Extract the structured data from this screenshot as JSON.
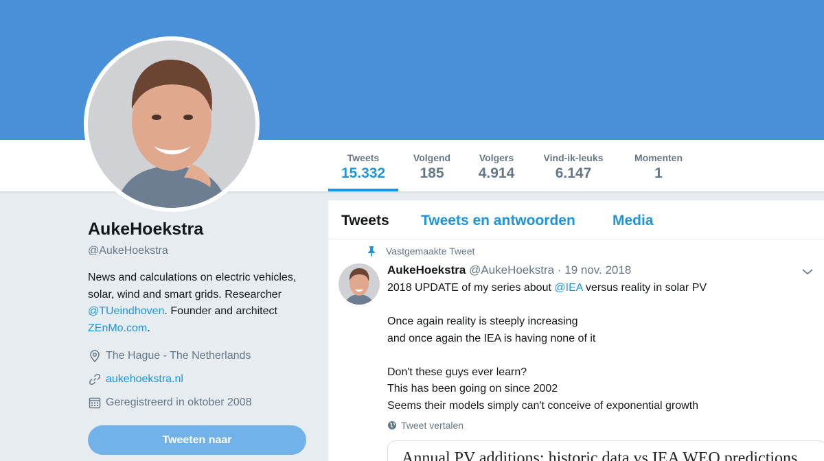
{
  "stats": [
    {
      "label": "Tweets",
      "value": "15.332"
    },
    {
      "label": "Volgend",
      "value": "185"
    },
    {
      "label": "Volgers",
      "value": "4.914"
    },
    {
      "label": "Vind-ik-leuks",
      "value": "6.147"
    },
    {
      "label": "Momenten",
      "value": "1"
    }
  ],
  "profile": {
    "name": "AukeHoekstra",
    "handle": "@AukeHoekstra",
    "bio": {
      "line1": "News and calculations on electric vehicles, solar, wind and smart grids. Researcher ",
      "mention": "@TUeindhoven",
      "line2": ". Founder and architect ",
      "site": "ZEnMo.com",
      "line3": "."
    },
    "location": "The Hague - The Netherlands",
    "website": "aukehoekstra.nl",
    "joined": "Geregistreerd in oktober 2008",
    "tweet_button": "Tweeten naar"
  },
  "tabs": [
    "Tweets",
    "Tweets en antwoorden",
    "Media"
  ],
  "tweet": {
    "pinned_label": "Vastgemaakte Tweet",
    "name": "AukeHoekstra",
    "handle": "@AukeHoekstra",
    "separator": "·",
    "date": "19 nov. 2018",
    "line1_pre": "2018 UPDATE of my series about ",
    "line1_mention": "@IEA",
    "line1_post": " versus reality in solar PV",
    "line2": "Once again reality is steeply increasing",
    "line3": "and once again the IEA is having none of it",
    "line4": "Don't these guys ever learn?",
    "line5": "This has been going on since 2002",
    "line6": "Seems their models simply can't conceive of exponential growth",
    "translate": "Tweet vertalen",
    "card_title": "Annual PV additions: historic data vs IEA WEO predictions"
  },
  "icons": {
    "pin": "pin-icon",
    "location": "location-pin-icon",
    "link": "link-icon",
    "calendar": "calendar-icon",
    "globe": "globe-icon",
    "chevron": "chevron-down-icon"
  },
  "colors": {
    "banner": "#4a90d9",
    "accent": "#1b95e0",
    "button": "#71b3e8",
    "muted": "#657786",
    "page": "#e6ecf0"
  }
}
